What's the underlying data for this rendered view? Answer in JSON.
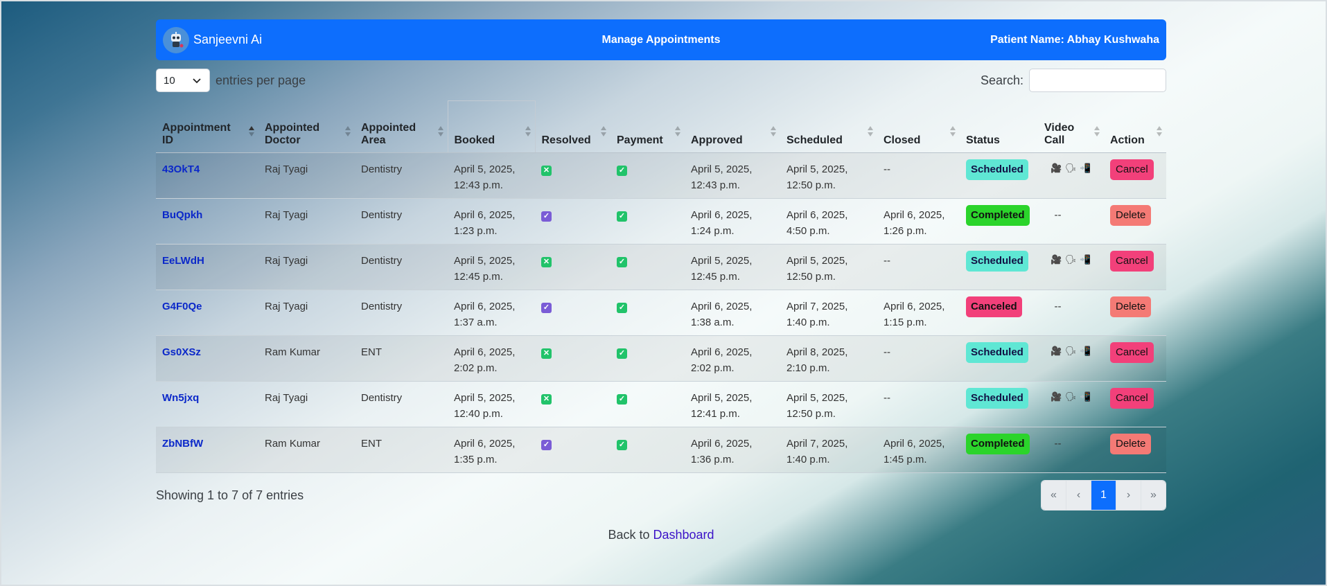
{
  "navbar": {
    "brand": "Sanjeevni Ai",
    "title": "Manage Appointments",
    "patient": "Patient Name: Abhay Kushwaha"
  },
  "controls": {
    "entries_value": "10",
    "entries_label": "entries per page",
    "search_label": "Search:",
    "search_value": ""
  },
  "table": {
    "headers": {
      "id": [
        "Appointment",
        "ID"
      ],
      "doctor": [
        "Appointed",
        "Doctor"
      ],
      "area": [
        "Appointed",
        "Area"
      ],
      "booked": "Booked",
      "resolved": "Resolved",
      "payment": "Payment",
      "approved": "Approved",
      "scheduled": "Scheduled",
      "closed": "Closed",
      "status": "Status",
      "video": [
        "Video",
        "Call"
      ],
      "action": "Action"
    },
    "rows": [
      {
        "id": "43OkT4",
        "doctor": "Raj Tyagi",
        "area": "Dentistry",
        "booked": [
          "April 5, 2025,",
          "12:43 p.m."
        ],
        "resolved": "x",
        "payment": "check",
        "approved": [
          "April 5, 2025,",
          "12:43 p.m."
        ],
        "scheduled": [
          "April 5, 2025,",
          "12:50 p.m."
        ],
        "closed": [
          "--",
          ""
        ],
        "status": "Scheduled",
        "video": true,
        "action": "Cancel"
      },
      {
        "id": "BuQpkh",
        "doctor": "Raj Tyagi",
        "area": "Dentistry",
        "booked": [
          "April 6, 2025,",
          "1:23 p.m."
        ],
        "resolved": "check-purple",
        "payment": "check",
        "approved": [
          "April 6, 2025,",
          "1:24 p.m."
        ],
        "scheduled": [
          "April 6, 2025,",
          "4:50 p.m."
        ],
        "closed": [
          "April 6, 2025,",
          "1:26 p.m."
        ],
        "status": "Completed",
        "video": false,
        "action": "Delete"
      },
      {
        "id": "EeLWdH",
        "doctor": "Raj Tyagi",
        "area": "Dentistry",
        "booked": [
          "April 5, 2025,",
          "12:45 p.m."
        ],
        "resolved": "x",
        "payment": "check",
        "approved": [
          "April 5, 2025,",
          "12:45 p.m."
        ],
        "scheduled": [
          "April 5, 2025,",
          "12:50 p.m."
        ],
        "closed": [
          "--",
          ""
        ],
        "status": "Scheduled",
        "video": true,
        "action": "Cancel"
      },
      {
        "id": "G4F0Qe",
        "doctor": "Raj Tyagi",
        "area": "Dentistry",
        "booked": [
          "April 6, 2025,",
          "1:37 a.m."
        ],
        "resolved": "check-purple",
        "payment": "check",
        "approved": [
          "April 6, 2025,",
          "1:38 a.m."
        ],
        "scheduled": [
          "April 7, 2025,",
          "1:40 p.m."
        ],
        "closed": [
          "April 6, 2025,",
          "1:15 p.m."
        ],
        "status": "Canceled",
        "video": false,
        "action": "Delete"
      },
      {
        "id": "Gs0XSz",
        "doctor": "Ram Kumar",
        "area": "ENT",
        "booked": [
          "April 6, 2025,",
          "2:02 p.m."
        ],
        "resolved": "x",
        "payment": "check",
        "approved": [
          "April 6, 2025,",
          "2:02 p.m."
        ],
        "scheduled": [
          "April 8, 2025,",
          "2:10 p.m."
        ],
        "closed": [
          "--",
          ""
        ],
        "status": "Scheduled",
        "video": true,
        "action": "Cancel"
      },
      {
        "id": "Wn5jxq",
        "doctor": "Raj Tyagi",
        "area": "Dentistry",
        "booked": [
          "April 5, 2025,",
          "12:40 p.m."
        ],
        "resolved": "x",
        "payment": "check",
        "approved": [
          "April 5, 2025,",
          "12:41 p.m."
        ],
        "scheduled": [
          "April 5, 2025,",
          "12:50 p.m."
        ],
        "closed": [
          "--",
          ""
        ],
        "status": "Scheduled",
        "video": true,
        "action": "Cancel"
      },
      {
        "id": "ZbNBfW",
        "doctor": "Ram Kumar",
        "area": "ENT",
        "booked": [
          "April 6, 2025,",
          "1:35 p.m."
        ],
        "resolved": "check-purple",
        "payment": "check",
        "approved": [
          "April 6, 2025,",
          "1:36 p.m."
        ],
        "scheduled": [
          "April 7, 2025,",
          "1:40 p.m."
        ],
        "closed": [
          "April 6, 2025,",
          "1:45 p.m."
        ],
        "status": "Completed",
        "video": false,
        "action": "Delete"
      }
    ],
    "empty_dash": "--",
    "video_icons": [
      "video-camera-icon",
      "speaking-head-icon",
      "mobile-phone-icon"
    ]
  },
  "footer": {
    "showing": "Showing 1 to 7 of 7 entries",
    "pager": [
      "«",
      "‹",
      "1",
      "›",
      "»"
    ],
    "active_page": "1",
    "back_prefix": "Back to",
    "back_link": "Dashboard"
  }
}
